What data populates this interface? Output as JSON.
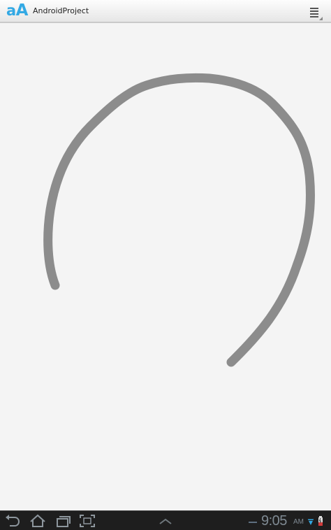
{
  "app": {
    "icon_text_small": "a",
    "icon_text_big": "A",
    "title": "AndroidProject",
    "accent_color": "#33a9e4"
  },
  "action_bar": {
    "menu_icon": "overflow-menu-icon"
  },
  "canvas": {
    "background_color": "#f4f4f4",
    "stroke_color": "#8c8c8c"
  },
  "system_bar": {
    "back_icon": "back-icon",
    "home_icon": "home-icon",
    "recent_apps_icon": "recent-apps-icon",
    "screenshot_icon": "screenshot-icon",
    "up_arrow_icon": "chevron-up-icon",
    "time": "9:05",
    "ampm": "AM",
    "status_icons": [
      "usb-icon",
      "wifi-icon",
      "battery-icon"
    ]
  }
}
